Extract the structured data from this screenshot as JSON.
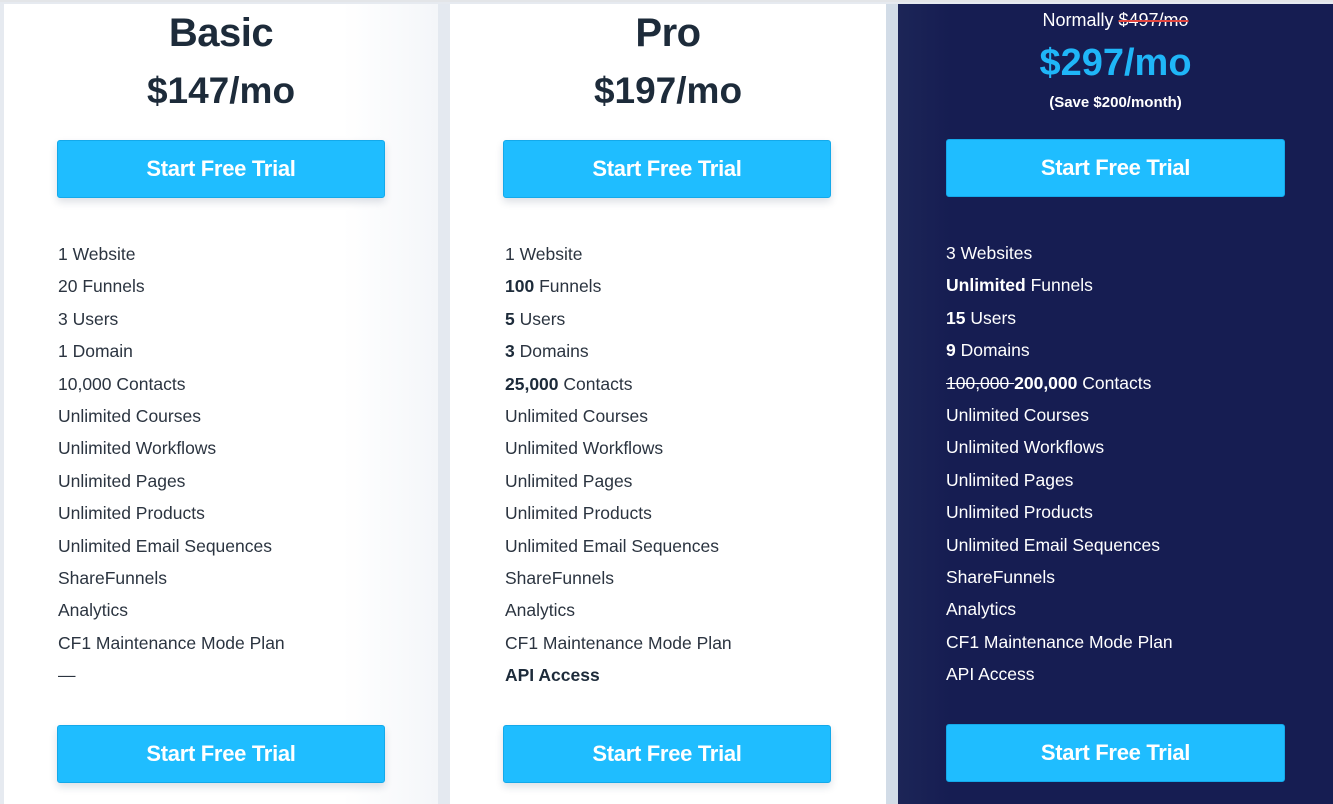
{
  "colors": {
    "accent_button": "#1fbdff",
    "premium_background": "#161d52",
    "premium_price": "#1fb6f8",
    "strike_red": "#e2463f",
    "heading_text": "#1d2b3a"
  },
  "plans": [
    {
      "id": "basic",
      "title": "Basic",
      "price": "$147/mo",
      "cta_top": "Start Free Trial",
      "cta_bottom": "Start Free Trial",
      "features": [
        {
          "bold": "",
          "text": "1 Website"
        },
        {
          "bold": "",
          "text": "20 Funnels"
        },
        {
          "bold": "",
          "text": "3 Users"
        },
        {
          "bold": "",
          "text": "1 Domain"
        },
        {
          "bold": "",
          "text": "10,000 Contacts"
        },
        {
          "bold": "",
          "text": "Unlimited Courses"
        },
        {
          "bold": "",
          "text": "Unlimited Workflows"
        },
        {
          "bold": "",
          "text": "Unlimited Pages"
        },
        {
          "bold": "",
          "text": "Unlimited Products"
        },
        {
          "bold": "",
          "text": "Unlimited Email Sequences"
        },
        {
          "bold": "",
          "text": "ShareFunnels"
        },
        {
          "bold": "",
          "text": "Analytics"
        },
        {
          "bold": "",
          "text": "CF1 Maintenance Mode Plan"
        },
        {
          "bold": "",
          "text": "—"
        }
      ]
    },
    {
      "id": "pro",
      "title": "Pro",
      "price": "$197/mo",
      "cta_top": "Start Free Trial",
      "cta_bottom": "Start Free Trial",
      "features": [
        {
          "bold": "",
          "text": "1 Website"
        },
        {
          "bold": "100",
          "text": " Funnels"
        },
        {
          "bold": "5",
          "text": " Users"
        },
        {
          "bold": "3",
          "text": " Domains"
        },
        {
          "bold": "25,000",
          "text": " Contacts"
        },
        {
          "bold": "",
          "text": "Unlimited Courses"
        },
        {
          "bold": "",
          "text": "Unlimited Workflows"
        },
        {
          "bold": "",
          "text": "Unlimited Pages"
        },
        {
          "bold": "",
          "text": "Unlimited Products"
        },
        {
          "bold": "",
          "text": "Unlimited Email Sequences"
        },
        {
          "bold": "",
          "text": "ShareFunnels"
        },
        {
          "bold": "",
          "text": "Analytics"
        },
        {
          "bold": "",
          "text": "CF1 Maintenance Mode Plan"
        },
        {
          "bold": "API Access",
          "text": ""
        }
      ]
    },
    {
      "id": "premium",
      "normally_label": "Normally ",
      "old_price": "$497/mo",
      "price": "$297/mo",
      "save_note": "(Save $200/month)",
      "cta_top": "Start Free Trial",
      "cta_bottom": "Start Free Trial",
      "features": [
        {
          "strike": "",
          "bold": "",
          "text": "3 Websites"
        },
        {
          "strike": "",
          "bold": "Unlimited",
          "text": " Funnels"
        },
        {
          "strike": "",
          "bold": "15",
          "text": " Users"
        },
        {
          "strike": "",
          "bold": "9",
          "text": " Domains"
        },
        {
          "strike": "100,000",
          "bold": "200,000",
          "text": " Contacts"
        },
        {
          "strike": "",
          "bold": "",
          "text": "Unlimited Courses"
        },
        {
          "strike": "",
          "bold": "",
          "text": "Unlimited Workflows"
        },
        {
          "strike": "",
          "bold": "",
          "text": "Unlimited Pages"
        },
        {
          "strike": "",
          "bold": "",
          "text": "Unlimited Products"
        },
        {
          "strike": "",
          "bold": "",
          "text": "Unlimited Email Sequences"
        },
        {
          "strike": "",
          "bold": "",
          "text": "ShareFunnels"
        },
        {
          "strike": "",
          "bold": "",
          "text": "Analytics"
        },
        {
          "strike": "",
          "bold": "",
          "text": "CF1 Maintenance Mode Plan"
        },
        {
          "strike": "",
          "bold": "",
          "text": "API Access"
        }
      ]
    }
  ]
}
